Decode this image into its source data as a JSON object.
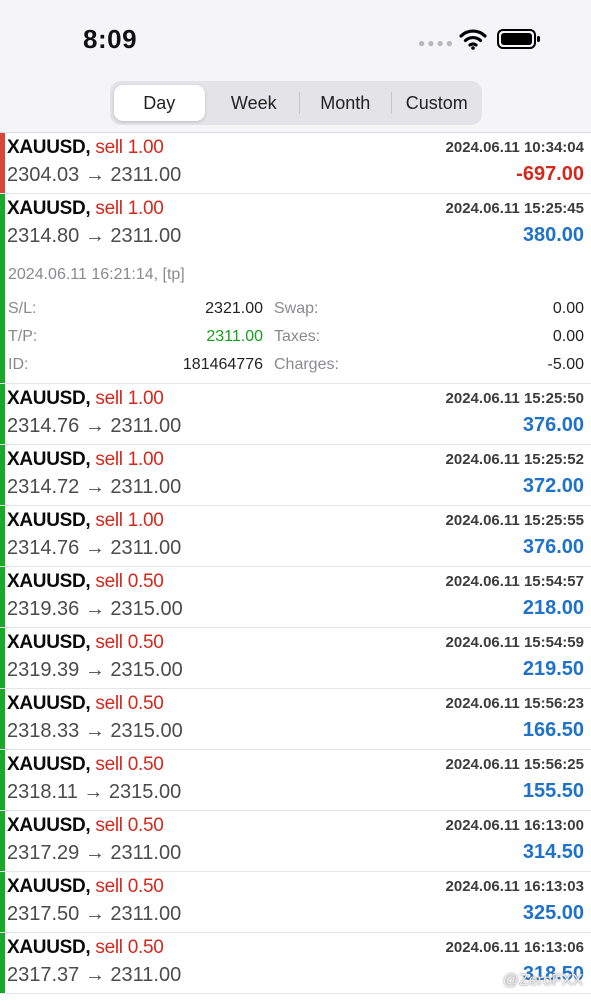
{
  "status": {
    "time": "8:09"
  },
  "header": {
    "tabs": [
      "Day",
      "Week",
      "Month",
      "Custom"
    ],
    "selected": "Day"
  },
  "colors": {
    "loss": "#d4281d",
    "profit": "#1f72c9",
    "win_bar": "#1aa72a",
    "loss_bar": "#d8453a",
    "tp_text": "#14a01f"
  },
  "deals": [
    {
      "symbol": "XAUUSD,",
      "action": "sell 1.00",
      "time": "2024.06.11 10:34:04",
      "prices": "2304.03 → 2311.00",
      "profit": "-697.00",
      "result": "loss"
    },
    {
      "symbol": "XAUUSD,",
      "action": "sell 1.00",
      "time": "2024.06.11 15:25:45",
      "prices": "2314.80 → 2311.00",
      "profit": "380.00",
      "result": "win",
      "expanded": {
        "close_info": "2024.06.11 16:21:14, [tp]",
        "sl_label": "S/L:",
        "sl_value": "2321.00",
        "tp_label": "T/P:",
        "tp_value": "2311.00",
        "id_label": "ID:",
        "id_value": "181464776",
        "swap_label": "Swap:",
        "swap_value": "0.00",
        "taxes_label": "Taxes:",
        "taxes_value": "0.00",
        "charges_label": "Charges:",
        "charges_value": "-5.00"
      }
    },
    {
      "symbol": "XAUUSD,",
      "action": "sell 1.00",
      "time": "2024.06.11 15:25:50",
      "prices": "2314.76 → 2311.00",
      "profit": "376.00",
      "result": "win"
    },
    {
      "symbol": "XAUUSD,",
      "action": "sell 1.00",
      "time": "2024.06.11 15:25:52",
      "prices": "2314.72 → 2311.00",
      "profit": "372.00",
      "result": "win"
    },
    {
      "symbol": "XAUUSD,",
      "action": "sell 1.00",
      "time": "2024.06.11 15:25:55",
      "prices": "2314.76 → 2311.00",
      "profit": "376.00",
      "result": "win"
    },
    {
      "symbol": "XAUUSD,",
      "action": "sell 0.50",
      "time": "2024.06.11 15:54:57",
      "prices": "2319.36 → 2315.00",
      "profit": "218.00",
      "result": "win"
    },
    {
      "symbol": "XAUUSD,",
      "action": "sell 0.50",
      "time": "2024.06.11 15:54:59",
      "prices": "2319.39 → 2315.00",
      "profit": "219.50",
      "result": "win"
    },
    {
      "symbol": "XAUUSD,",
      "action": "sell 0.50",
      "time": "2024.06.11 15:56:23",
      "prices": "2318.33 → 2315.00",
      "profit": "166.50",
      "result": "win"
    },
    {
      "symbol": "XAUUSD,",
      "action": "sell 0.50",
      "time": "2024.06.11 15:56:25",
      "prices": "2318.11 → 2315.00",
      "profit": "155.50",
      "result": "win"
    },
    {
      "symbol": "XAUUSD,",
      "action": "sell 0.50",
      "time": "2024.06.11 16:13:00",
      "prices": "2317.29 → 2311.00",
      "profit": "314.50",
      "result": "win"
    },
    {
      "symbol": "XAUUSD,",
      "action": "sell 0.50",
      "time": "2024.06.11 16:13:03",
      "prices": "2317.50 → 2311.00",
      "profit": "325.00",
      "result": "win"
    },
    {
      "symbol": "XAUUSD,",
      "action": "sell 0.50",
      "time": "2024.06.11 16:13:06",
      "prices": "2317.37 → 2311.00",
      "profit": "318.50",
      "result": "win"
    }
  ],
  "watermark": "@ZeroFXX"
}
